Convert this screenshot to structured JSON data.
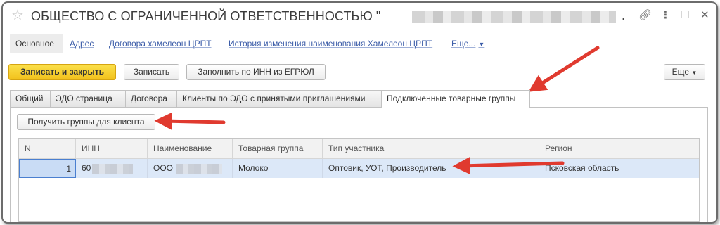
{
  "window": {
    "title": "ОБЩЕСТВО С ОГРАНИЧЕННОЙ ОТВЕТСТВЕННОСТЬЮ \"",
    "title_suffix": "."
  },
  "nav": {
    "items": [
      {
        "label": "Основное"
      },
      {
        "label": "Адрес"
      },
      {
        "label": "Договора хамелеон ЦРПТ"
      },
      {
        "label": "История изменения наименования Хамелеон ЦРПТ"
      },
      {
        "label": "Еще..."
      }
    ]
  },
  "toolbar": {
    "save_close": "Записать и закрыть",
    "save": "Записать",
    "fill_inn": "Заполнить по ИНН из ЕГРЮЛ",
    "more": "Еще"
  },
  "tabs": [
    {
      "label": "Общий"
    },
    {
      "label": "ЭДО страница"
    },
    {
      "label": "Договора"
    },
    {
      "label": "Клиенты по ЭДО с принятыми приглашениями"
    },
    {
      "label": "Подключенные товарные группы"
    }
  ],
  "panel": {
    "get_groups_button": "Получить группы для клиента"
  },
  "table": {
    "columns": [
      "N",
      "ИНН",
      "Наименование",
      "Товарная группа",
      "Тип участника",
      "Регион"
    ],
    "rows": [
      {
        "n": "1",
        "inn": "60",
        "name": "ООО",
        "group": "Молоко",
        "type": "Оптовик, УОТ, Производитель",
        "region": "Псковская область"
      }
    ]
  },
  "colors": {
    "primary_button": "#f2c11c",
    "selected_row": "#dce8f8",
    "link": "#3b5ca8",
    "arrow": "#e03a2f"
  }
}
